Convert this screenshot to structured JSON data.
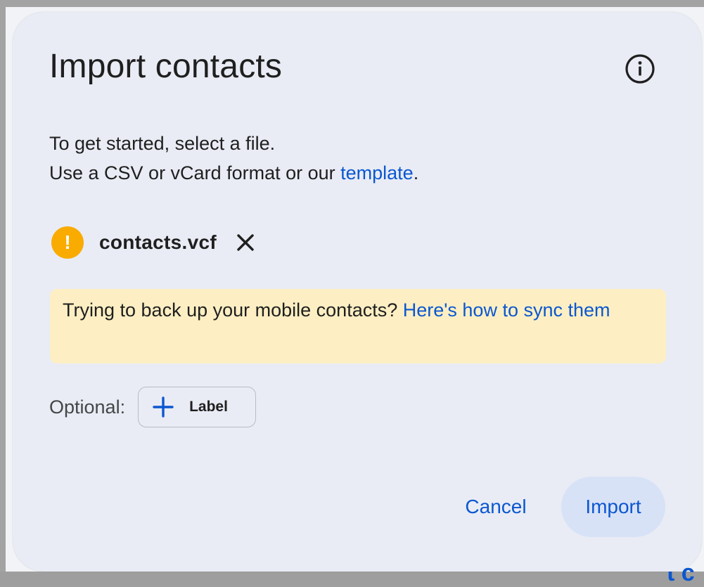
{
  "dialog": {
    "title": "Import contacts",
    "info_icon": "info-icon",
    "intro_line1": "To get started, select a file.",
    "intro_line2_prefix": "Use a CSV or vCard format or our ",
    "intro_link": "template",
    "intro_line2_suffix": "."
  },
  "file": {
    "status_icon": "warning-icon",
    "status_glyph": "!",
    "name": "contacts.vcf",
    "remove_icon": "close-icon"
  },
  "banner": {
    "text": "Trying to back up your mobile contacts? ",
    "link": "Here's how to sync them"
  },
  "optional": {
    "label": "Optional:",
    "button_label": "Label",
    "button_icon": "plus-icon"
  },
  "actions": {
    "cancel": "Cancel",
    "import": "Import"
  },
  "background": {
    "fragment": "t c"
  },
  "colors": {
    "accent": "#0b57d0",
    "warning": "#f9ab00",
    "banner_bg": "#fdefc3",
    "dialog_bg": "#e9ecf5",
    "import_bg": "#d8e2f7"
  }
}
